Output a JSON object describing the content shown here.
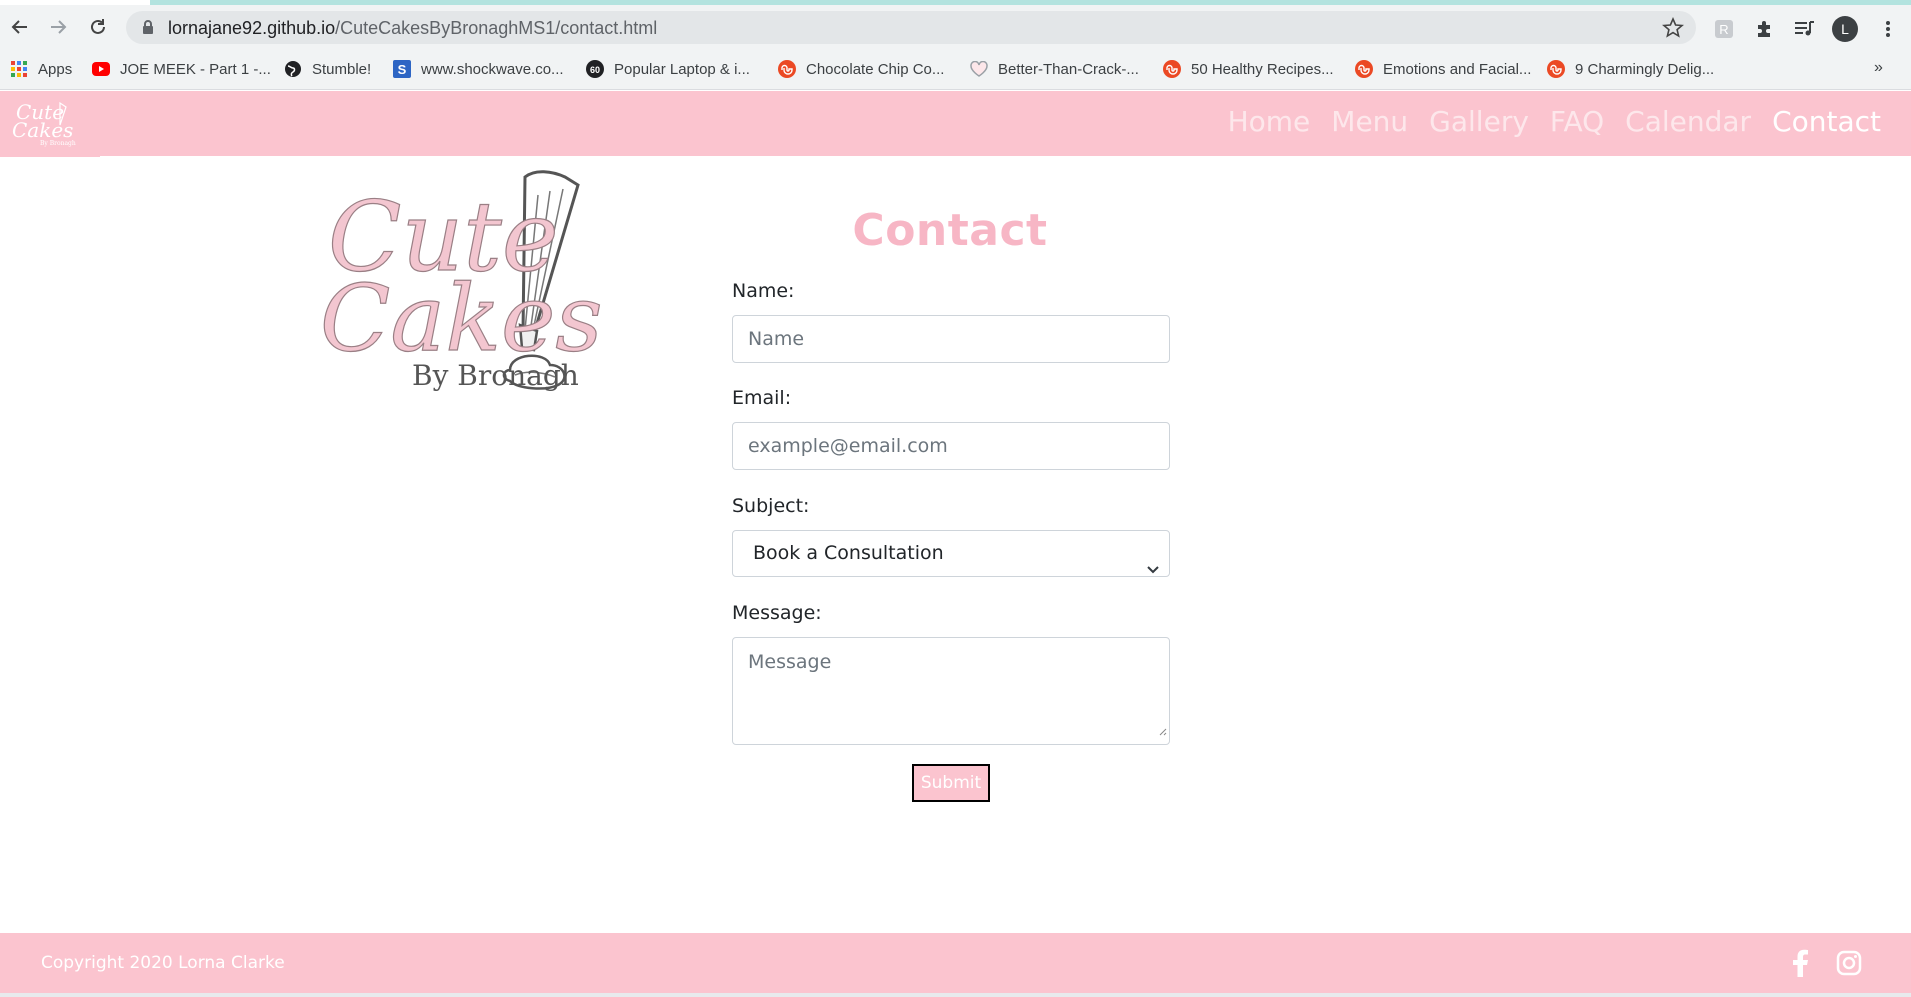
{
  "browser": {
    "url_host": "lornajane92.github.io",
    "url_path": "/CuteCakesByBronaghMS1/contact.html",
    "profile_initial": "L",
    "bookmarks": [
      {
        "label": "Apps",
        "icon": "apps-grid-icon"
      },
      {
        "label": "JOE MEEK - Part 1 -...",
        "icon": "youtube-icon"
      },
      {
        "label": "Stumble!",
        "icon": "globe-icon"
      },
      {
        "label": "www.shockwave.co...",
        "icon": "shockwave-icon"
      },
      {
        "label": "Popular Laptop & i...",
        "icon": "sixty-icon"
      },
      {
        "label": "Chocolate Chip Co...",
        "icon": "stumbleupon-icon"
      },
      {
        "label": "Better-Than-Crack-...",
        "icon": "heart-icon"
      },
      {
        "label": "50 Healthy Recipes...",
        "icon": "stumbleupon-icon"
      },
      {
        "label": "Emotions and Facial...",
        "icon": "stumbleupon-icon"
      },
      {
        "label": "9 Charmingly Delig...",
        "icon": "stumbleupon-icon"
      }
    ],
    "more_label": "»"
  },
  "nav": {
    "links": [
      "Home",
      "Menu",
      "Gallery",
      "FAQ",
      "Calendar",
      "Contact"
    ],
    "active": "Contact"
  },
  "logo": {
    "line1": "Cute",
    "line2": "Cakes",
    "line3": "By Bronagh"
  },
  "form": {
    "title": "Contact",
    "name_label": "Name:",
    "name_placeholder": "Name",
    "email_label": "Email:",
    "email_placeholder": "example@email.com",
    "subject_label": "Subject:",
    "subject_selected": "Book a Consultation",
    "message_label": "Message:",
    "message_placeholder": "Message",
    "submit_label": "Submit"
  },
  "footer": {
    "copyright": "Copyright 2020 Lorna Clarke",
    "social": [
      "facebook-icon",
      "instagram-icon"
    ]
  },
  "colors": {
    "brand_pink": "#fbc4cf",
    "title_pink": "#f7b6c5",
    "text_dark": "#212529"
  }
}
